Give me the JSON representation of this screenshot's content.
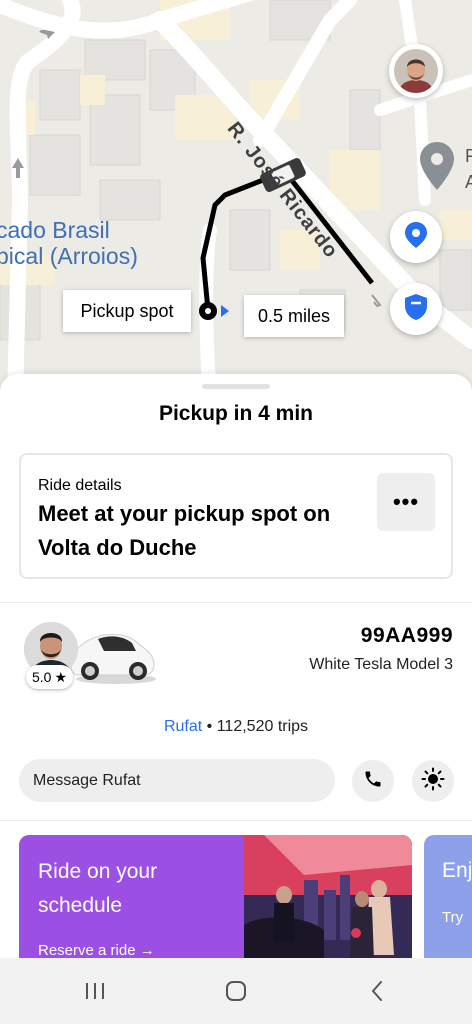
{
  "map": {
    "area_label_line1": "cado Brasil",
    "area_label_line2": "pical (Arroios)",
    "street_label": "R. José Ricardo",
    "edge_letters": [
      "F",
      "A"
    ],
    "pickup_label": "Pickup spot",
    "distance_label": "0.5 miles",
    "colors": {
      "route": "#000000",
      "locate_icon": "#276ef1",
      "shield_icon": "#276ef1"
    }
  },
  "sheet": {
    "title": "Pickup in 4 min",
    "ride_details": {
      "caption": "Ride details",
      "message": "Meet at your pickup spot on Volta do Duche",
      "more_icon": "more-horizontal-icon"
    },
    "driver": {
      "rating": "5.0",
      "rating_icon": "star-icon",
      "plate": "99AA999",
      "car_model": "White Tesla Model 3",
      "name": "Rufat",
      "trips": "112,520 trips",
      "separator": "•"
    },
    "message": {
      "placeholder": "Message Rufat",
      "call_icon": "phone-icon",
      "light_icon": "brightness-icon"
    },
    "promos": [
      {
        "title": "Ride on your schedule",
        "link": "Reserve a ride",
        "link_icon": "arrow-right-icon",
        "color": "#9c4fe3"
      },
      {
        "title": "Enj",
        "link": "Try",
        "color": "#8fa0ea"
      }
    ]
  },
  "navbar": {
    "items": [
      "recent-apps-icon",
      "home-icon",
      "back-icon"
    ]
  }
}
